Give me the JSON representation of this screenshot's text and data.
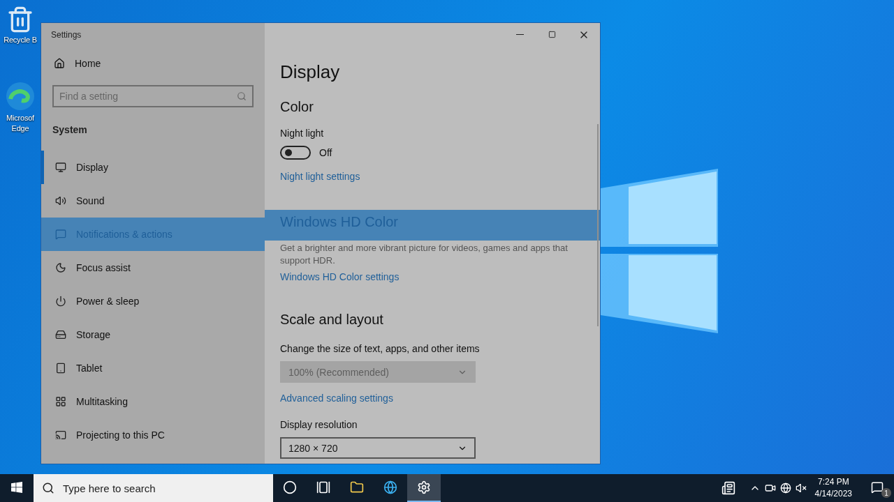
{
  "desktop_icons": [
    {
      "kind": "recycle",
      "lines": [
        "Recycle B"
      ]
    },
    {
      "kind": "edge",
      "lines": [
        "Microsof",
        "Edge"
      ]
    }
  ],
  "window": {
    "title": "Settings"
  },
  "sidebar": {
    "home": "Home",
    "search": {
      "placeholder": "Find a setting"
    },
    "section": "System",
    "items": [
      {
        "kind": "display",
        "label": "Display",
        "selected": true,
        "highlighted": false
      },
      {
        "kind": "sound",
        "label": "Sound",
        "selected": false,
        "highlighted": false
      },
      {
        "kind": "notifications",
        "label": "Notifications & actions",
        "selected": false,
        "highlighted": true
      },
      {
        "kind": "focus",
        "label": "Focus assist",
        "selected": false,
        "highlighted": false
      },
      {
        "kind": "power",
        "label": "Power & sleep",
        "selected": false,
        "highlighted": false
      },
      {
        "kind": "storage",
        "label": "Storage",
        "selected": false,
        "highlighted": false
      },
      {
        "kind": "tablet",
        "label": "Tablet",
        "selected": false,
        "highlighted": false
      },
      {
        "kind": "multitasking",
        "label": "Multitasking",
        "selected": false,
        "highlighted": false
      },
      {
        "kind": "projecting",
        "label": "Projecting to this PC",
        "selected": false,
        "highlighted": false
      }
    ]
  },
  "content": {
    "title": "Display",
    "color": {
      "heading": "Color",
      "night_light": {
        "label": "Night light",
        "on": false,
        "state_text": "Off"
      },
      "link": "Night light settings"
    },
    "hd_color": {
      "heading": "Windows HD Color",
      "highlighted": true,
      "description": "Get a brighter and more vibrant picture for videos, games and apps that support HDR.",
      "link": "Windows HD Color settings"
    },
    "scale": {
      "heading": "Scale and layout",
      "size_label": "Change the size of text, apps, and other items",
      "size_dropdown": {
        "value": "100% (Recommended)",
        "disabled": true
      },
      "link": "Advanced scaling settings",
      "resolution_label": "Display resolution",
      "resolution_dropdown": {
        "value": "1280 × 720",
        "disabled": false
      }
    }
  },
  "taskbar": {
    "search": {
      "placeholder": "Type here to search"
    },
    "apps": [
      {
        "kind": "cortana",
        "selected": false
      },
      {
        "kind": "taskview",
        "selected": false
      },
      {
        "kind": "explorer",
        "selected": false
      },
      {
        "kind": "edge",
        "selected": false
      },
      {
        "kind": "settings",
        "selected": true
      }
    ],
    "time": "7:24 PM",
    "date": "4/14/2023",
    "notification_count": "1"
  }
}
